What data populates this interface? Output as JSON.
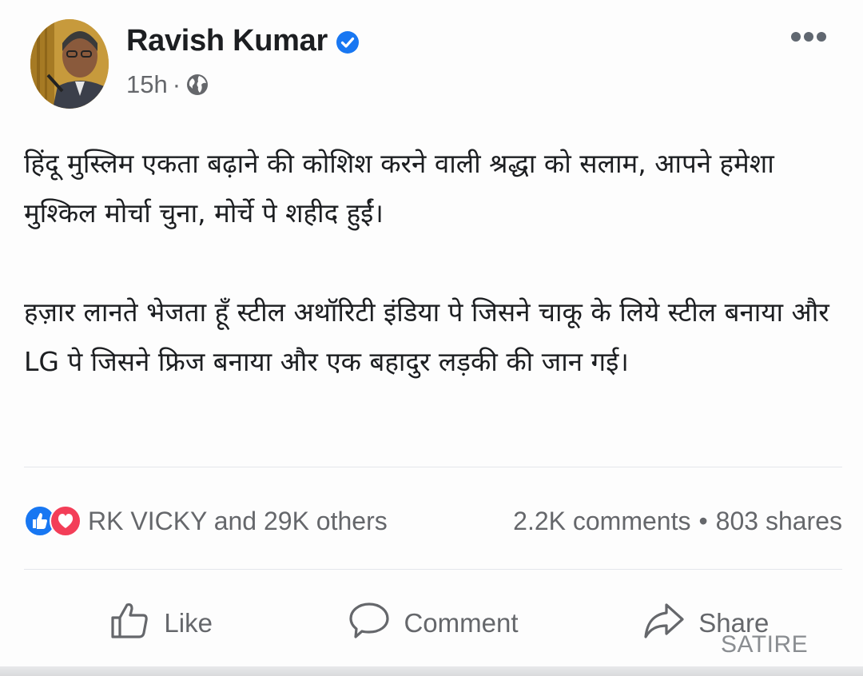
{
  "post": {
    "author": "Ravish Kumar",
    "time": "15h",
    "separator": "·",
    "paragraphs": [
      "हिंदू मुस्लिम एकता बढ़ाने की कोशिश करने वाली श्रद्धा को सलाम, आपने हमेशा मुश्किल मोर्चा चुना, मोर्चे पे शहीद हुईं।",
      "हज़ार लानते भेजता हूँ स्टील अथॉरिटी इंडिया पे जिसने चाकू के लिये स्टील बनाया और LG पे जिसने फ्रिज बनाया और एक बहादुर लड़की की जान गई।"
    ]
  },
  "stats": {
    "reactions_text": "RK VICKY and 29K others",
    "comments": "2.2K comments",
    "dot": "•",
    "shares": "803 shares"
  },
  "actions": {
    "like": "Like",
    "comment": "Comment",
    "share": "Share"
  },
  "watermark": "SATIRE",
  "colors": {
    "verified": "#1877f2",
    "like_reaction": "#1877f2",
    "love_reaction": "#f33e58",
    "secondary_text": "#65676b"
  },
  "icons": [
    "verified-badge-icon",
    "globe-icon",
    "more-dots-icon",
    "like-reaction-icon",
    "love-reaction-icon",
    "thumbs-up-icon",
    "speech-bubble-icon",
    "share-arrow-icon"
  ]
}
